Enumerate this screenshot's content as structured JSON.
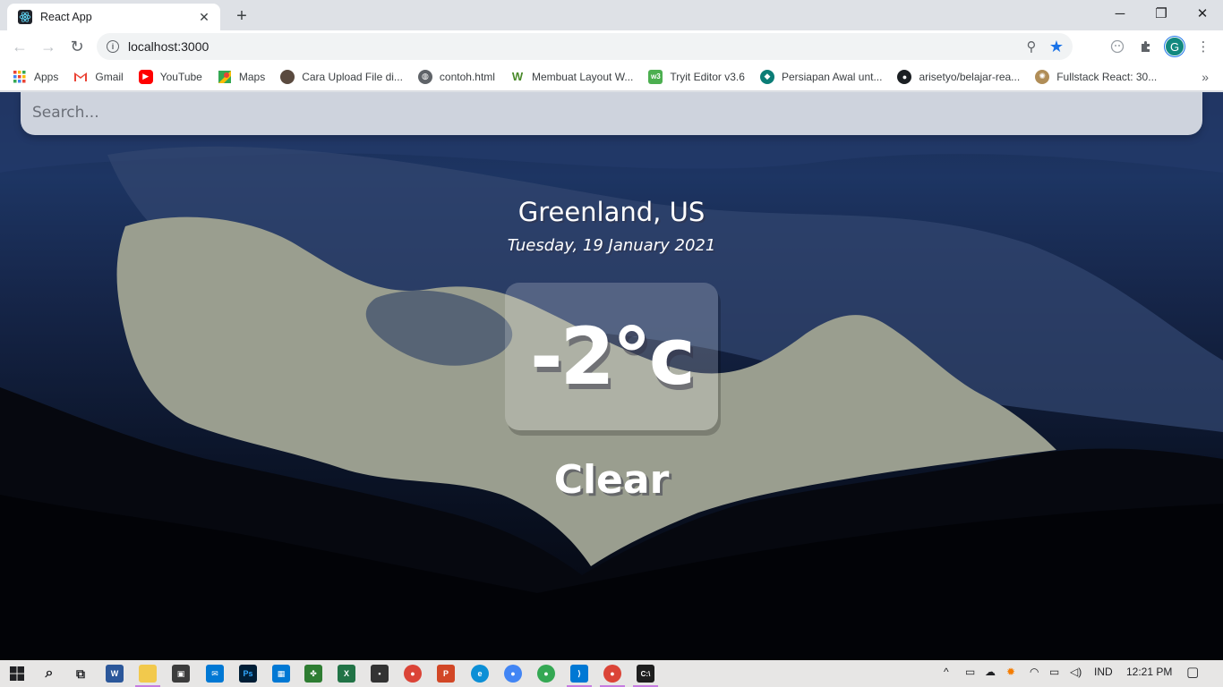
{
  "browser": {
    "tab_title": "React App",
    "url": "localhost:3000",
    "avatar_letter": "G",
    "accent_color": "#1a73e8"
  },
  "bookmarks": [
    {
      "label": "Apps",
      "icon": "apps-grid-icon"
    },
    {
      "label": "Gmail",
      "icon": "gmail-icon"
    },
    {
      "label": "YouTube",
      "icon": "youtube-icon"
    },
    {
      "label": "Maps",
      "icon": "maps-icon"
    },
    {
      "label": "Cara Upload File di...",
      "icon": "avatar-icon"
    },
    {
      "label": "contoh.html",
      "icon": "globe-icon"
    },
    {
      "label": "Membuat Layout W...",
      "icon": "w-icon"
    },
    {
      "label": "Tryit Editor v3.6",
      "icon": "w3schools-icon"
    },
    {
      "label": "Persiapan Awal unt...",
      "icon": "teal-icon"
    },
    {
      "label": "arisetyo/belajar-rea...",
      "icon": "github-icon"
    },
    {
      "label": "Fullstack React: 30...",
      "icon": "fullstack-icon"
    }
  ],
  "app": {
    "search_placeholder": "Search...",
    "location": "Greenland, US",
    "date": "Tuesday, 19 January 2021",
    "temperature": "-2°c",
    "weather": "Clear"
  },
  "taskbar": {
    "language": "IND",
    "time": "12:21 PM"
  }
}
